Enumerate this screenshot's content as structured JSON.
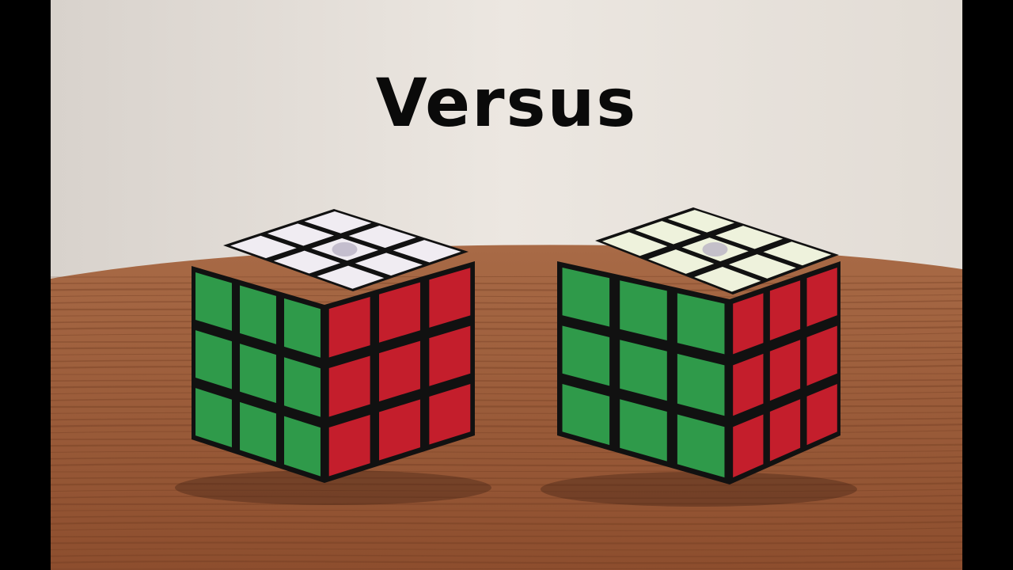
{
  "overlay": {
    "title": "Versus"
  },
  "scene": {
    "colors": {
      "letterbox": "#000000",
      "wall": "#e9e3dc",
      "table": "#9a5a38",
      "table_grain": "#6e3a20",
      "cube_body": "#111111",
      "sticker_white": "#f0ecf2",
      "sticker_white_right_cube": "#eef2dc",
      "sticker_green": "#2f9a4a",
      "sticker_red": "#c41e2c"
    },
    "cubes": [
      {
        "name": "left-cube",
        "top": "white",
        "front": "green",
        "side": "red",
        "center_logo": true
      },
      {
        "name": "right-cube",
        "top": "white",
        "front": "green",
        "side": "red",
        "center_logo": true
      }
    ]
  }
}
